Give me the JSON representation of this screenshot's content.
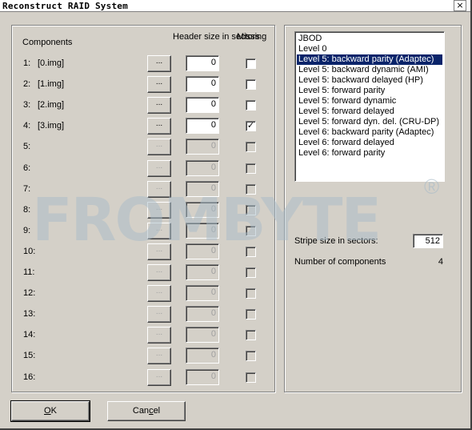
{
  "window": {
    "title": "Reconstruct RAID System",
    "close_glyph": "×"
  },
  "headers": {
    "components": "Components",
    "header_size": "Header size in sectors",
    "missing": "Missing"
  },
  "components": [
    {
      "num": "1:",
      "name": "[0.img]",
      "browse": "...",
      "header_size": "0",
      "missing": false,
      "enabled": true
    },
    {
      "num": "2:",
      "name": "[1.img]",
      "browse": "...",
      "header_size": "0",
      "missing": false,
      "enabled": true
    },
    {
      "num": "3:",
      "name": "[2.img]",
      "browse": "...",
      "header_size": "0",
      "missing": false,
      "enabled": true
    },
    {
      "num": "4:",
      "name": "[3.img]",
      "browse": "...",
      "header_size": "0",
      "missing": true,
      "enabled": true
    },
    {
      "num": "5:",
      "name": "",
      "browse": "...",
      "header_size": "0",
      "missing": false,
      "enabled": false
    },
    {
      "num": "6:",
      "name": "",
      "browse": "...",
      "header_size": "0",
      "missing": false,
      "enabled": false
    },
    {
      "num": "7:",
      "name": "",
      "browse": "...",
      "header_size": "0",
      "missing": false,
      "enabled": false
    },
    {
      "num": "8:",
      "name": "",
      "browse": "...",
      "header_size": "0",
      "missing": false,
      "enabled": false
    },
    {
      "num": "9:",
      "name": "",
      "browse": "...",
      "header_size": "0",
      "missing": false,
      "enabled": false
    },
    {
      "num": "10:",
      "name": "",
      "browse": "...",
      "header_size": "0",
      "missing": false,
      "enabled": false
    },
    {
      "num": "11:",
      "name": "",
      "browse": "...",
      "header_size": "0",
      "missing": false,
      "enabled": false
    },
    {
      "num": "12:",
      "name": "",
      "browse": "...",
      "header_size": "0",
      "missing": false,
      "enabled": false
    },
    {
      "num": "13:",
      "name": "",
      "browse": "...",
      "header_size": "0",
      "missing": false,
      "enabled": false
    },
    {
      "num": "14:",
      "name": "",
      "browse": "...",
      "header_size": "0",
      "missing": false,
      "enabled": false
    },
    {
      "num": "15:",
      "name": "",
      "browse": "...",
      "header_size": "0",
      "missing": false,
      "enabled": false
    },
    {
      "num": "16:",
      "name": "",
      "browse": "...",
      "header_size": "0",
      "missing": false,
      "enabled": false
    }
  ],
  "raid_types": {
    "items": [
      "JBOD",
      "Level 0",
      "Level 5: backward parity (Adaptec)",
      "Level 5: backward dynamic (AMI)",
      "Level 5: backward delayed (HP)",
      "Level 5: forward parity",
      "Level 5: forward dynamic",
      "Level 5: forward delayed",
      "Level 5: forward dyn. del. (CRU-DP)",
      "Level 6: backward parity (Adaptec)",
      "Level 6: forward delayed",
      "Level 6: forward parity"
    ],
    "selected": "Level 5: backward parity (Adaptec)"
  },
  "stripe": {
    "label": "Stripe size in sectors:",
    "value": "512"
  },
  "num_components": {
    "label": "Number of components",
    "value": "4"
  },
  "buttons": {
    "ok_hotkey": "O",
    "ok_rest": "K",
    "cancel_pre": "Can",
    "cancel_hotkey": "c",
    "cancel_rest": "el"
  },
  "watermark": {
    "text": "FROMBYTE",
    "mark": "®"
  },
  "colors": {
    "dialog_bg": "#d4d0c8",
    "selection": "#0a246a",
    "watermark": "#a9bcc8"
  }
}
